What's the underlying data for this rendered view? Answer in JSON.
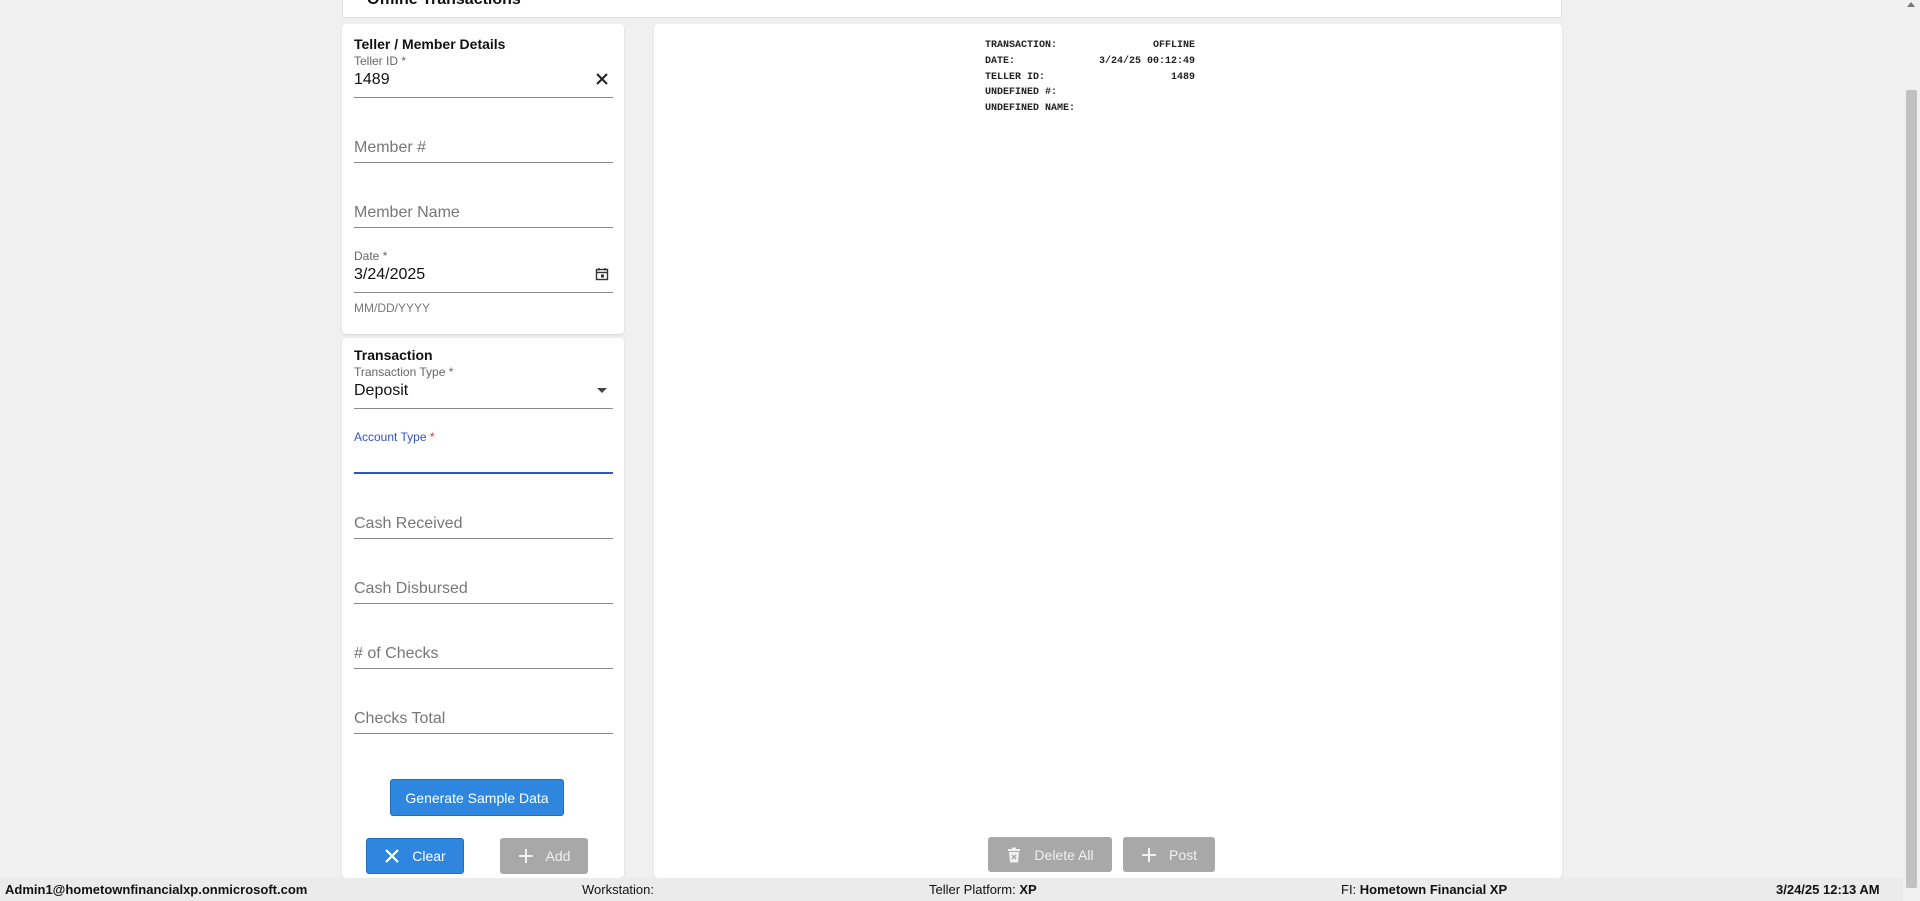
{
  "page": {
    "title": "Offline Transactions"
  },
  "teller_details": {
    "title": "Teller / Member Details",
    "teller_id": {
      "label": "Teller ID *",
      "value": "1489",
      "clear_icon": "close-icon"
    },
    "member_number": {
      "placeholder": "Member #"
    },
    "member_name": {
      "placeholder": "Member Name"
    },
    "date": {
      "label": "Date *",
      "value": "3/24/2025",
      "helper": "MM/DD/YYYY",
      "icon": "calendar-icon"
    }
  },
  "transaction": {
    "title": "Transaction",
    "transaction_type": {
      "label": "Transaction Type *",
      "value": "Deposit",
      "icon": "dropdown-arrow-icon"
    },
    "account_type": {
      "label": "Account Type *",
      "value": ""
    },
    "cash_received": {
      "placeholder": "Cash Received"
    },
    "cash_disbursed": {
      "placeholder": "Cash Disbursed"
    },
    "num_checks": {
      "placeholder": "# of Checks"
    },
    "checks_total": {
      "placeholder": "Checks Total"
    },
    "generate_button": "Generate Sample Data",
    "clear_button": "Clear",
    "add_button": "Add"
  },
  "receipt": {
    "lines": [
      {
        "label": "TRANSACTION:",
        "value": "OFFLINE"
      },
      {
        "label": "DATE:",
        "value": "3/24/25 00:12:49"
      },
      {
        "label": "TELLER ID:",
        "value": "1489"
      },
      {
        "label": "UNDEFINED #:",
        "value": ""
      },
      {
        "label": "UNDEFINED NAME:",
        "value": ""
      }
    ],
    "delete_all_button": "Delete All",
    "post_button": "Post"
  },
  "statusbar": {
    "user": "Admin1@hometownfinancialxp.onmicrosoft.com",
    "workstation_label": "Workstation:",
    "workstation_value": "",
    "platform_label": "Teller Platform:",
    "platform_value": "XP",
    "fi_label": "FI:",
    "fi_value": "Hometown Financial XP",
    "datetime": "3/24/25 12:13 AM"
  },
  "colors": {
    "primary": "#2e86de",
    "focus": "#2f55c5",
    "disabled": "#a8a8a8"
  }
}
